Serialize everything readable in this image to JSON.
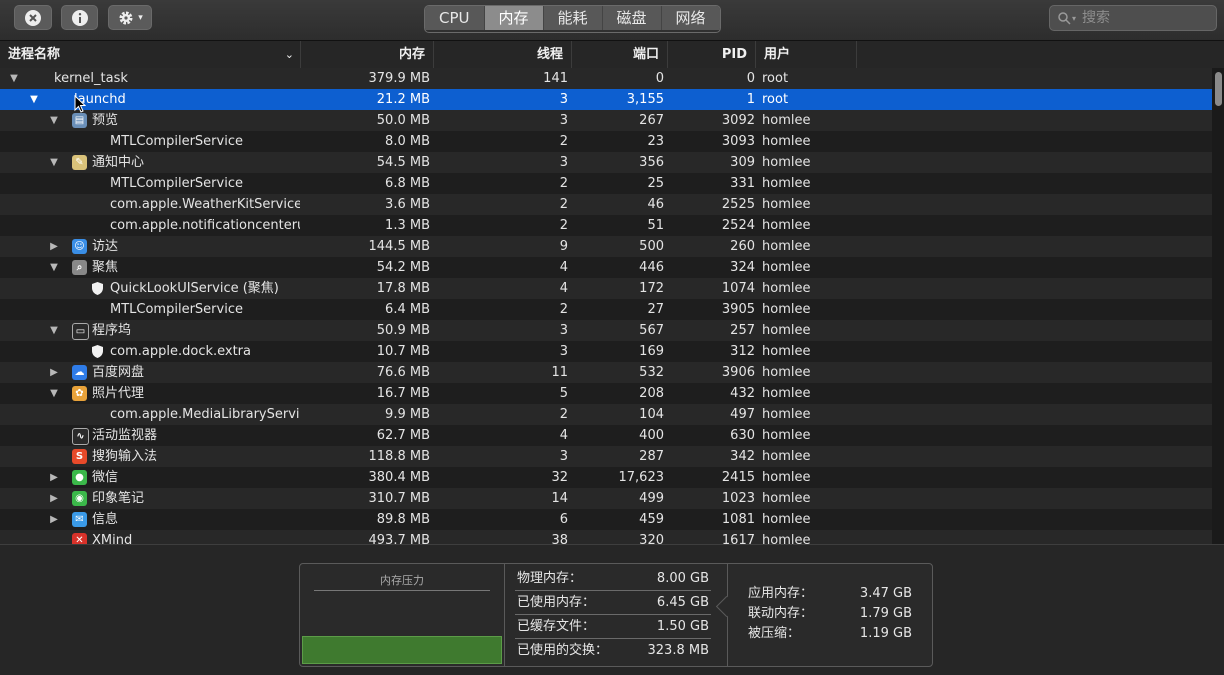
{
  "toolbar": {
    "segments": [
      "CPU",
      "内存",
      "能耗",
      "磁盘",
      "网络"
    ],
    "active_segment": "内存",
    "search_placeholder": "搜索"
  },
  "columns": {
    "name": "进程名称",
    "memory": "内存",
    "threads": "线程",
    "ports": "端口",
    "pid": "PID",
    "user": "用户"
  },
  "rows": [
    {
      "indent": 0,
      "disc": "open",
      "icon": "",
      "name": "kernel_task",
      "mem": "379.9 MB",
      "thr": "141",
      "port": "0",
      "pid": "0",
      "user": "root"
    },
    {
      "indent": 1,
      "disc": "open",
      "icon": "",
      "name": "launchd",
      "mem": "21.2 MB",
      "thr": "3",
      "port": "3,155",
      "pid": "1",
      "user": "root",
      "selected": true
    },
    {
      "indent": 2,
      "disc": "open",
      "icon": "preview",
      "name": "预览",
      "mem": "50.0 MB",
      "thr": "3",
      "port": "267",
      "pid": "3092",
      "user": "homlee"
    },
    {
      "indent": 3,
      "disc": "",
      "icon": "",
      "name": "MTLCompilerService",
      "mem": "8.0 MB",
      "thr": "2",
      "port": "23",
      "pid": "3093",
      "user": "homlee"
    },
    {
      "indent": 2,
      "disc": "open",
      "icon": "notes",
      "name": "通知中心",
      "mem": "54.5 MB",
      "thr": "3",
      "port": "356",
      "pid": "309",
      "user": "homlee"
    },
    {
      "indent": 3,
      "disc": "",
      "icon": "",
      "name": "MTLCompilerService",
      "mem": "6.8 MB",
      "thr": "2",
      "port": "25",
      "pid": "331",
      "user": "homlee"
    },
    {
      "indent": 3,
      "disc": "",
      "icon": "",
      "name": "com.apple.WeatherKitService",
      "mem": "3.6 MB",
      "thr": "2",
      "port": "46",
      "pid": "2525",
      "user": "homlee"
    },
    {
      "indent": 3,
      "disc": "",
      "icon": "",
      "name": "com.apple.notificationcenterui.",
      "mem": "1.3 MB",
      "thr": "2",
      "port": "51",
      "pid": "2524",
      "user": "homlee"
    },
    {
      "indent": 2,
      "disc": "closed",
      "icon": "finder",
      "name": "访达",
      "mem": "144.5 MB",
      "thr": "9",
      "port": "500",
      "pid": "260",
      "user": "homlee"
    },
    {
      "indent": 2,
      "disc": "open",
      "icon": "spotlight",
      "name": "聚焦",
      "mem": "54.2 MB",
      "thr": "4",
      "port": "446",
      "pid": "324",
      "user": "homlee"
    },
    {
      "indent": 3,
      "disc": "",
      "icon": "shield",
      "name": "QuickLookUIService (聚焦)",
      "mem": "17.8 MB",
      "thr": "4",
      "port": "172",
      "pid": "1074",
      "user": "homlee"
    },
    {
      "indent": 3,
      "disc": "",
      "icon": "",
      "name": "MTLCompilerService",
      "mem": "6.4 MB",
      "thr": "2",
      "port": "27",
      "pid": "3905",
      "user": "homlee"
    },
    {
      "indent": 2,
      "disc": "open",
      "icon": "dock",
      "name": "程序坞",
      "mem": "50.9 MB",
      "thr": "3",
      "port": "567",
      "pid": "257",
      "user": "homlee"
    },
    {
      "indent": 3,
      "disc": "",
      "icon": "shield",
      "name": "com.apple.dock.extra",
      "mem": "10.7 MB",
      "thr": "3",
      "port": "169",
      "pid": "312",
      "user": "homlee"
    },
    {
      "indent": 2,
      "disc": "closed",
      "icon": "baidu",
      "name": "百度网盘",
      "mem": "76.6 MB",
      "thr": "11",
      "port": "532",
      "pid": "3906",
      "user": "homlee"
    },
    {
      "indent": 2,
      "disc": "open",
      "icon": "photos",
      "name": "照片代理",
      "mem": "16.7 MB",
      "thr": "5",
      "port": "208",
      "pid": "432",
      "user": "homlee"
    },
    {
      "indent": 3,
      "disc": "",
      "icon": "",
      "name": "com.apple.MediaLibraryServi...",
      "mem": "9.9 MB",
      "thr": "2",
      "port": "104",
      "pid": "497",
      "user": "homlee"
    },
    {
      "indent": 2,
      "disc": "",
      "icon": "monitor",
      "name": "活动监视器",
      "mem": "62.7 MB",
      "thr": "4",
      "port": "400",
      "pid": "630",
      "user": "homlee"
    },
    {
      "indent": 2,
      "disc": "",
      "icon": "sogou",
      "name": "搜狗输入法",
      "mem": "118.8 MB",
      "thr": "3",
      "port": "287",
      "pid": "342",
      "user": "homlee"
    },
    {
      "indent": 2,
      "disc": "closed",
      "icon": "wechat",
      "name": "微信",
      "mem": "380.4 MB",
      "thr": "32",
      "port": "17,623",
      "pid": "2415",
      "user": "homlee"
    },
    {
      "indent": 2,
      "disc": "closed",
      "icon": "evernote",
      "name": "印象笔记",
      "mem": "310.7 MB",
      "thr": "14",
      "port": "499",
      "pid": "1023",
      "user": "homlee"
    },
    {
      "indent": 2,
      "disc": "closed",
      "icon": "messages",
      "name": "信息",
      "mem": "89.8 MB",
      "thr": "6",
      "port": "459",
      "pid": "1081",
      "user": "homlee"
    },
    {
      "indent": 2,
      "disc": "",
      "icon": "xmind",
      "name": "XMind",
      "mem": "493.7 MB",
      "thr": "38",
      "port": "320",
      "pid": "1617",
      "user": "homlee"
    }
  ],
  "icon_colors": {
    "preview": "#6a8fb8",
    "notes": "#d9c27a",
    "finder": "#3a8ee6",
    "spotlight": "#888888",
    "shield": "#ffffff",
    "dock": "#2a2a2a",
    "baidu": "#2f7ce8",
    "photos": "#e8a23a",
    "monitor": "#2a2a2a",
    "sogou": "#e84a2a",
    "wechat": "#3bb84a",
    "evernote": "#3bb84a",
    "messages": "#3a9ae8",
    "xmind": "#d8322a"
  },
  "memory_panel": {
    "pressure_title": "内存压力",
    "pressure_level": 0.22,
    "physical_label": "物理内存：",
    "physical_value": "8.00 GB",
    "used_label": "已使用内存：",
    "used_value": "6.45 GB",
    "cached_label": "已缓存文件：",
    "cached_value": "1.50 GB",
    "swap_label": "已使用的交换：",
    "swap_value": "323.8 MB",
    "app_label": "应用内存：",
    "app_value": "3.47 GB",
    "wired_label": "联动内存：",
    "wired_value": "1.79 GB",
    "compressed_label": "被压缩：",
    "compressed_value": "1.19 GB"
  }
}
